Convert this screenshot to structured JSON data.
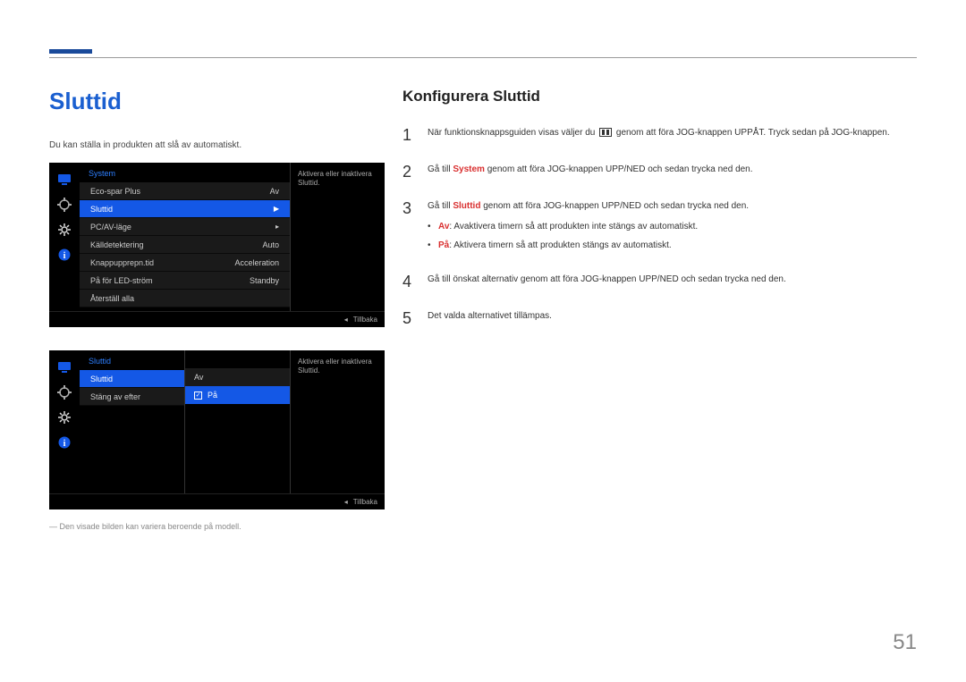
{
  "page_number": "51",
  "left": {
    "title": "Sluttid",
    "desc": "Du kan ställa in produkten att slå av automatiskt.",
    "footnote": "― Den visade bilden kan variera beroende på modell."
  },
  "osd1": {
    "title": "System",
    "desc": "Aktivera eller inaktivera Sluttid.",
    "rows": [
      {
        "label": "Eco-spar Plus",
        "value": "Av"
      },
      {
        "label": "Sluttid",
        "value": "▶",
        "sel": true
      },
      {
        "label": "PC/AV-läge",
        "value": "▸"
      },
      {
        "label": "Källdetektering",
        "value": "Auto"
      },
      {
        "label": "Knappupprepn.tid",
        "value": "Acceleration"
      },
      {
        "label": "På för LED-ström",
        "value": "Standby"
      },
      {
        "label": "Återställ alla",
        "value": ""
      }
    ],
    "back": "Tillbaka"
  },
  "osd2": {
    "title": "Sluttid",
    "desc": "Aktivera eller inaktivera Sluttid.",
    "rows": [
      {
        "label": "Sluttid",
        "sel": true
      },
      {
        "label": "Stäng av efter"
      }
    ],
    "sub": [
      {
        "label": "Av"
      },
      {
        "label": "På",
        "sel": true
      }
    ],
    "back": "Tillbaka"
  },
  "right": {
    "title": "Konfigurera Sluttid",
    "steps": {
      "s1a": "När funktionsknappsguiden visas väljer du ",
      "s1b": " genom att föra JOG-knappen UPPÅT. Tryck sedan på JOG-knappen.",
      "s2a": "Gå till ",
      "s2_sys": "System",
      "s2b": " genom att föra JOG-knappen UPP/NED och sedan trycka ned den.",
      "s3a": "Gå till ",
      "s3_slut": "Sluttid",
      "s3b": " genom att föra JOG-knappen UPP/NED och sedan trycka ned den.",
      "b_av_k": "Av",
      "b_av_v": ": Avaktivera timern så att produkten inte stängs av automatiskt.",
      "b_pa_k": "På",
      "b_pa_v": ": Aktivera timern så att produkten stängs av automatiskt.",
      "s4": "Gå till önskat alternativ genom att föra JOG-knappen UPP/NED och sedan trycka ned den.",
      "s5": "Det valda alternativet tillämpas."
    }
  }
}
